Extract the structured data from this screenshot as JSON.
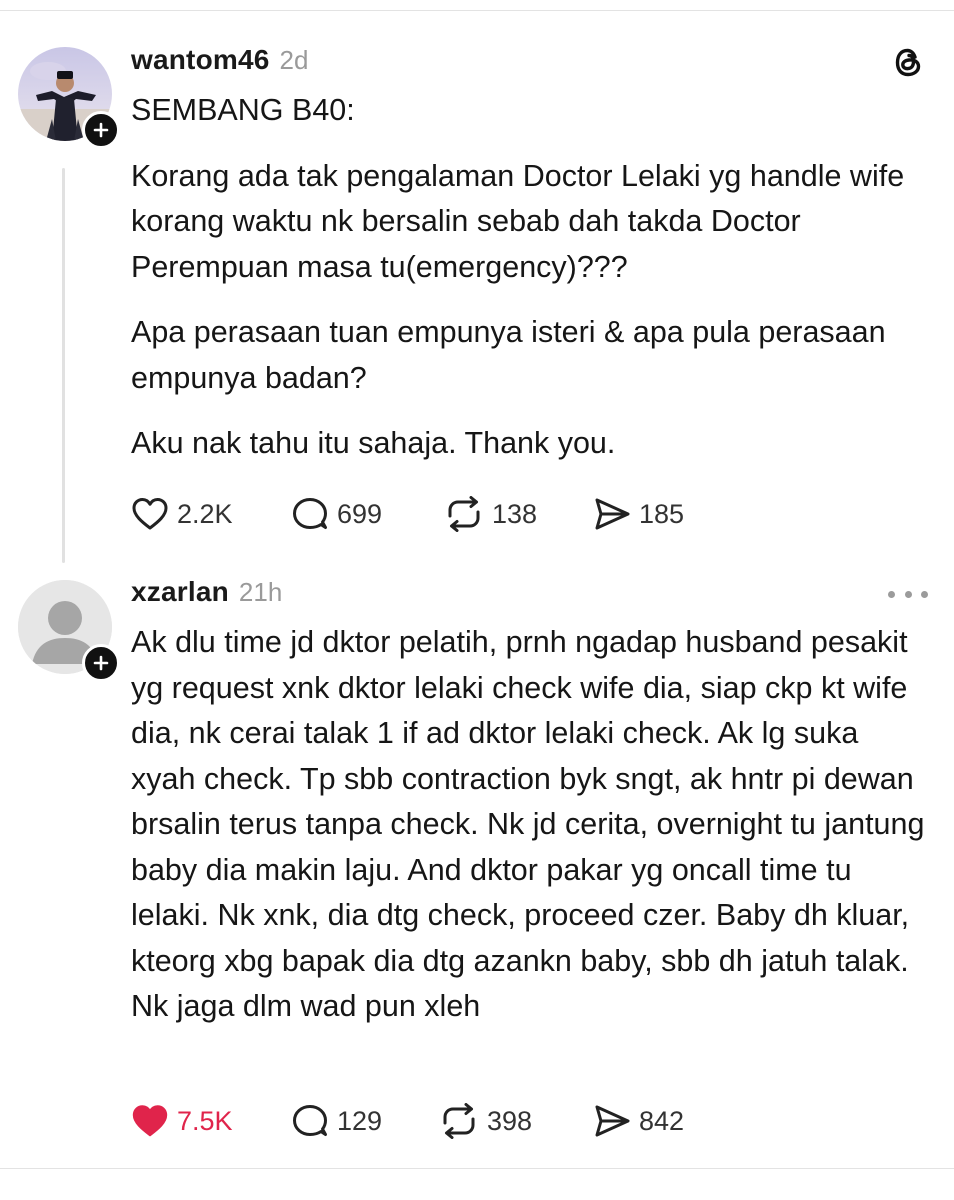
{
  "posts": [
    {
      "username": "wantom46",
      "time": "2d",
      "paragraphs": [
        "SEMBANG B40:",
        "Korang ada tak pengalaman Doctor Lelaki yg handle wife korang waktu nk bersalin sebab dah takda Doctor Perempuan masa tu(emergency)???",
        "Apa perasaan tuan empunya isteri & apa pula perasaan empunya badan?",
        "Aku nak tahu itu sahaja. Thank you."
      ],
      "likes": "2.2K",
      "replies": "699",
      "reposts": "138",
      "shares": "185",
      "liked": false
    },
    {
      "username": "xzarlan",
      "time": "21h",
      "paragraphs": [
        "Ak dlu time jd dktor pelatih, prnh ngadap husband pesakit yg request xnk dktor lelaki check wife dia, siap ckp kt wife dia, nk cerai talak 1 if ad dktor lelaki check. Ak lg suka xyah check. Tp sbb contraction byk sngt, ak hntr pi dewan brsalin terus tanpa check. Nk jd cerita, overnight tu jantung baby dia makin laju. And dktor pakar yg oncall time tu lelaki. Nk xnk, dia dtg check, proceed czer. Baby dh kluar, kteorg xbg bapak dia dtg azankn baby, sbb dh jatuh talak. Nk jaga dlm wad pun xleh"
      ],
      "likes": "7.5K",
      "replies": "129",
      "reposts": "398",
      "shares": "842",
      "liked": true
    }
  ],
  "icons": {
    "app_logo": "threads-logo-icon",
    "more": "more-options-icon",
    "like": "heart-icon",
    "reply": "comment-bubble-icon",
    "repost": "repost-icon",
    "share": "send-icon",
    "follow": "plus-icon"
  },
  "colors": {
    "liked": "#e0244b",
    "text": "#161616",
    "muted": "#9a9a9a",
    "badge": "#111111"
  }
}
